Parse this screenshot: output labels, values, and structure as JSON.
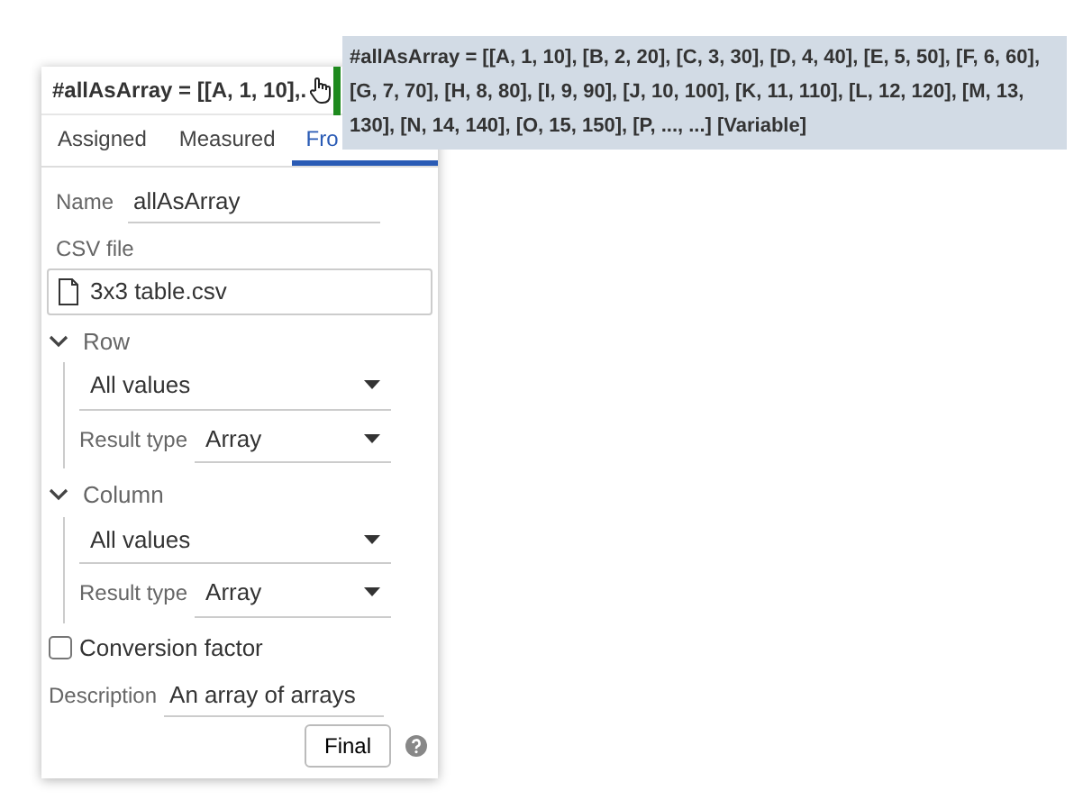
{
  "header": {
    "title": "#allAsArray = [[A, 1, 10],."
  },
  "tooltip": {
    "text": "#allAsArray = [[A, 1, 10], [B, 2, 20], [C, 3, 30], [D, 4, 40], [E, 5, 50], [F, 6, 60], [G, 7, 70], [H, 8, 80], [I, 9, 90], [J, 10, 100], [K, 11, 110], [L, 12, 120], [M, 13, 130], [N, 14, 140], [O, 15, 150], [P, ..., ...] [Variable]"
  },
  "tabs": [
    {
      "label": "Assigned",
      "selected": false
    },
    {
      "label": "Measured",
      "selected": false
    },
    {
      "label": "Fro",
      "selected": true
    }
  ],
  "name": {
    "label": "Name",
    "value": "allAsArray"
  },
  "csv": {
    "label": "CSV file",
    "value": "3x3 table.csv"
  },
  "sections": [
    {
      "title": "Row",
      "expanded": true,
      "selection": "All values",
      "result_label": "Result type",
      "result_value": "Array"
    },
    {
      "title": "Column",
      "expanded": true,
      "selection": "All values",
      "result_label": "Result type",
      "result_value": "Array"
    }
  ],
  "conversion": {
    "label": "Conversion factor",
    "checked": false
  },
  "description": {
    "label": "Description",
    "value": "An array of arrays"
  },
  "button": "Final"
}
